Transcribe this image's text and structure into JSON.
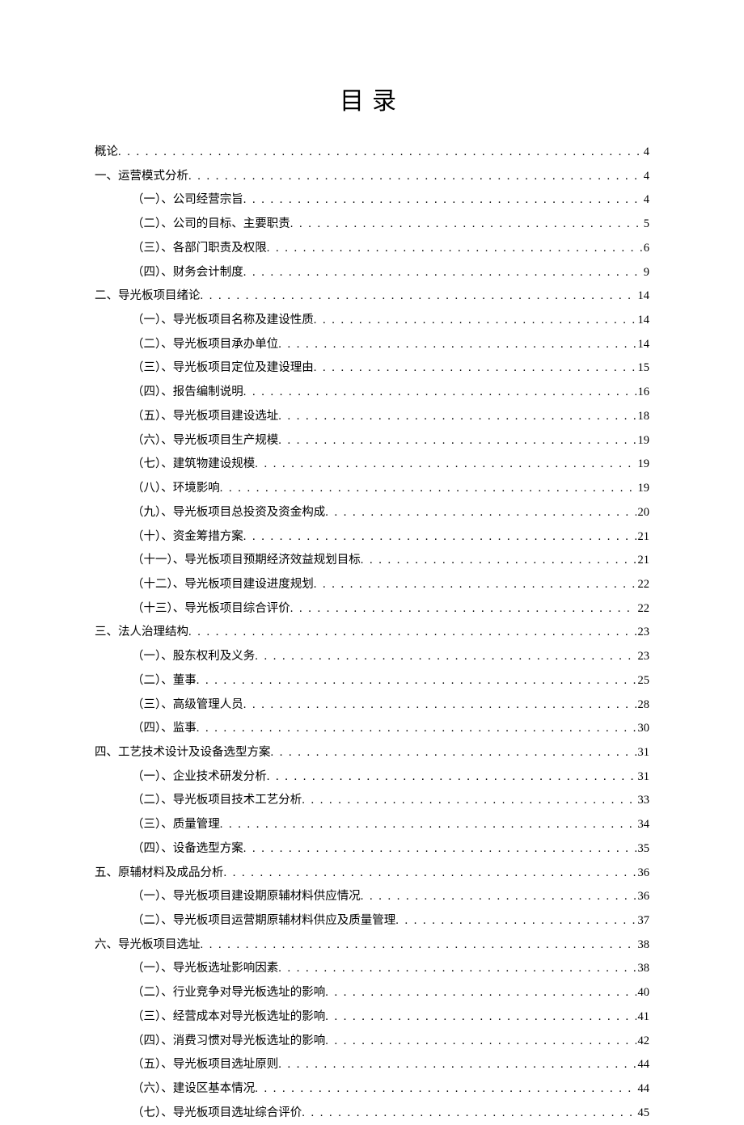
{
  "title": "目录",
  "entries": [
    {
      "level": 0,
      "label": "概论",
      "page": "4"
    },
    {
      "level": 1,
      "label": "一、运营模式分析",
      "page": "4"
    },
    {
      "level": 2,
      "label": "（一）、公司经营宗旨",
      "page": "4"
    },
    {
      "level": 2,
      "label": "（二）、公司的目标、主要职责",
      "page": "5"
    },
    {
      "level": 2,
      "label": "（三）、各部门职责及权限",
      "page": "6"
    },
    {
      "level": 2,
      "label": "（四）、财务会计制度",
      "page": "9"
    },
    {
      "level": 1,
      "label": "二、导光板项目绪论",
      "page": "14"
    },
    {
      "level": 2,
      "label": "（一）、导光板项目名称及建设性质",
      "page": "14"
    },
    {
      "level": 2,
      "label": "（二）、导光板项目承办单位",
      "page": "14"
    },
    {
      "level": 2,
      "label": "（三）、导光板项目定位及建设理由",
      "page": "15"
    },
    {
      "level": 2,
      "label": "（四）、报告编制说明",
      "page": "16"
    },
    {
      "level": 2,
      "label": "（五）、导光板项目建设选址",
      "page": "18"
    },
    {
      "level": 2,
      "label": "（六）、导光板项目生产规模",
      "page": "19"
    },
    {
      "level": 2,
      "label": "（七）、建筑物建设规模",
      "page": "19"
    },
    {
      "level": 2,
      "label": "（八）、环境影响",
      "page": "19"
    },
    {
      "level": 2,
      "label": "（九）、导光板项目总投资及资金构成",
      "page": "20"
    },
    {
      "level": 2,
      "label": "（十）、资金筹措方案",
      "page": "21"
    },
    {
      "level": 2,
      "label": "（十一）、导光板项目预期经济效益规划目标",
      "page": "21"
    },
    {
      "level": 2,
      "label": "（十二）、导光板项目建设进度规划",
      "page": "22"
    },
    {
      "level": 2,
      "label": "（十三）、导光板项目综合评价",
      "page": "22"
    },
    {
      "level": 1,
      "label": "三、法人治理结构",
      "page": "23"
    },
    {
      "level": 2,
      "label": "（一）、股东权利及义务",
      "page": "23"
    },
    {
      "level": 2,
      "label": "（二）、董事",
      "page": "25"
    },
    {
      "level": 2,
      "label": "（三）、高级管理人员",
      "page": "28"
    },
    {
      "level": 2,
      "label": "（四）、监事",
      "page": "30"
    },
    {
      "level": 1,
      "label": "四、工艺技术设计及设备选型方案",
      "page": "31"
    },
    {
      "level": 2,
      "label": "（一）、企业技术研发分析",
      "page": "31"
    },
    {
      "level": 2,
      "label": "（二）、导光板项目技术工艺分析",
      "page": "33"
    },
    {
      "level": 2,
      "label": "（三）、质量管理",
      "page": "34"
    },
    {
      "level": 2,
      "label": "（四）、设备选型方案",
      "page": "35"
    },
    {
      "level": 1,
      "label": "五、原辅材料及成品分析",
      "page": "36"
    },
    {
      "level": 2,
      "label": "（一）、导光板项目建设期原辅材料供应情况",
      "page": "36"
    },
    {
      "level": 2,
      "label": "（二）、导光板项目运营期原辅材料供应及质量管理",
      "page": "37"
    },
    {
      "level": 1,
      "label": "六、导光板项目选址",
      "page": "38"
    },
    {
      "level": 2,
      "label": "（一）、导光板选址影响因素",
      "page": "38"
    },
    {
      "level": 2,
      "label": "（二）、行业竞争对导光板选址的影响",
      "page": "40"
    },
    {
      "level": 2,
      "label": "（三）、经营成本对导光板选址的影响",
      "page": "41"
    },
    {
      "level": 2,
      "label": "（四）、消费习惯对导光板选址的影响",
      "page": "42"
    },
    {
      "level": 2,
      "label": "（五）、导光板项目选址原则",
      "page": "44"
    },
    {
      "level": 2,
      "label": "（六）、建设区基本情况",
      "page": "44"
    },
    {
      "level": 2,
      "label": "（七）、导光板项目选址综合评价",
      "page": "45"
    }
  ]
}
